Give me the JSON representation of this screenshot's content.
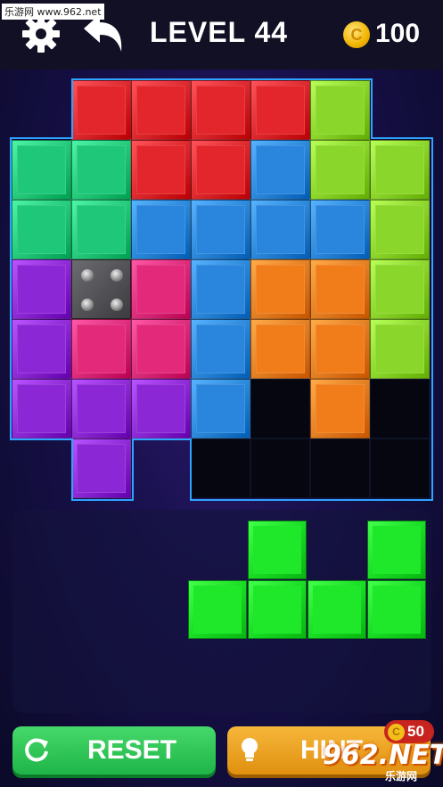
{
  "watermark": {
    "site": "乐游网 www.962.net",
    "logo": "962.NET",
    "logo_sub": "乐游网"
  },
  "header": {
    "settings_icon": "gear-icon",
    "back_icon": "undo-arrow-icon",
    "level_label": "LEVEL 44",
    "coin_symbol": "C",
    "coins": "100"
  },
  "board": {
    "outline_color": "#2ea3ff",
    "colors": {
      "R": "#e3262c",
      "L": "#8ad62a",
      "T": "#1fc879",
      "B": "#2a86dd",
      "P": "#8c27d6",
      "K": "#e32a7a",
      "O": "#f07d1a"
    },
    "grid": [
      [
        "",
        "R",
        "R",
        "R",
        "R",
        "L",
        ""
      ],
      [
        "T",
        "T",
        "R",
        "R",
        "B",
        "L",
        "L"
      ],
      [
        "T",
        "T",
        "B",
        "B",
        "B",
        "B",
        "L"
      ],
      [
        "P",
        "X",
        "K",
        "B",
        "O",
        "O",
        "L"
      ],
      [
        "P",
        "K",
        "K",
        "B",
        "O",
        "O",
        "L"
      ],
      [
        "P",
        "P",
        "P",
        "B",
        "E",
        "O",
        "E"
      ],
      [
        "",
        "P",
        "",
        "E",
        "E",
        "E",
        "E"
      ]
    ]
  },
  "tray": {
    "piece_color": "#1ee829",
    "piece_cells": [
      [
        2,
        0
      ],
      [
        4,
        0
      ],
      [
        1,
        1
      ],
      [
        2,
        1
      ],
      [
        3,
        1
      ],
      [
        4,
        1
      ]
    ]
  },
  "buttons": {
    "reset_label": "RESET",
    "hint_label": "HINT",
    "hint_cost": "50",
    "reset_icon": "refresh-icon",
    "hint_icon": "lightbulb-icon"
  }
}
